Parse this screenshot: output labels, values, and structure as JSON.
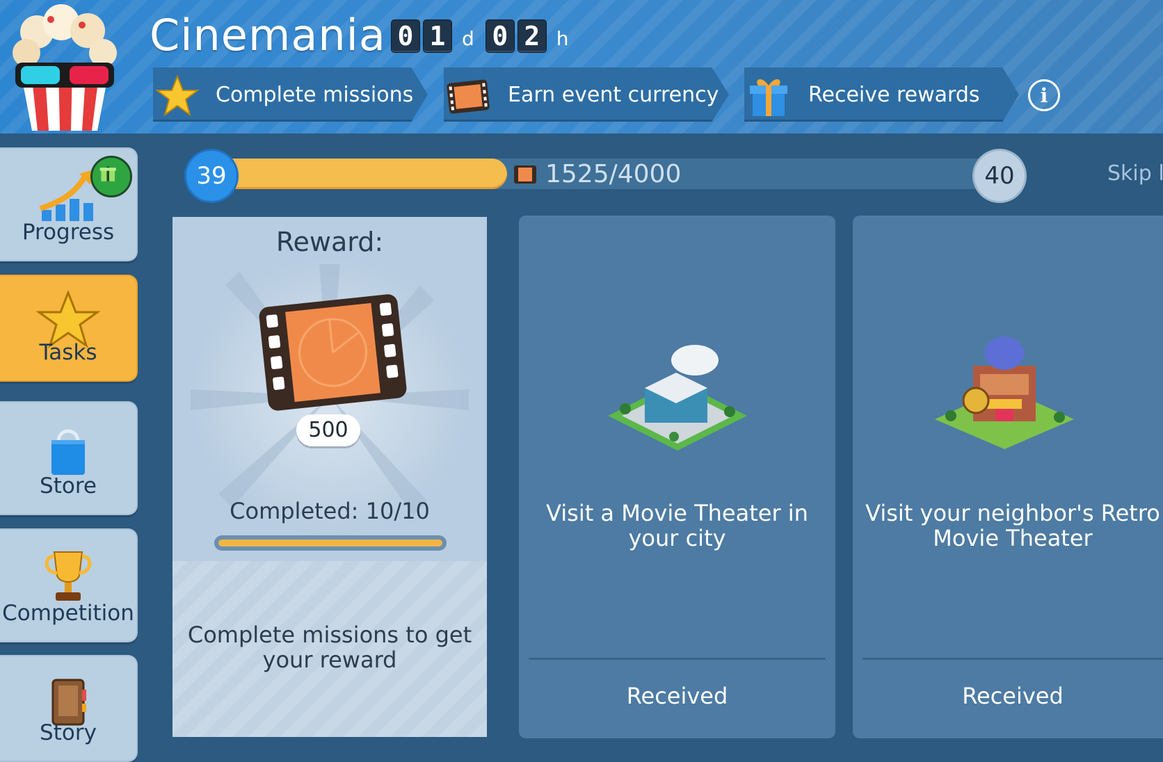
{
  "header": {
    "title": "Cinemania",
    "timer": {
      "days": [
        "0",
        "1"
      ],
      "days_unit": "d",
      "hours": [
        "0",
        "2"
      ],
      "hours_unit": "h"
    },
    "steps": [
      {
        "label": "Complete missions",
        "icon": "star-icon"
      },
      {
        "label": "Earn event currency",
        "icon": "film-reel-icon"
      },
      {
        "label": "Receive rewards",
        "icon": "gift-icon"
      }
    ],
    "info_icon_text": "i"
  },
  "sidebar": {
    "items": [
      {
        "label": "Progress",
        "icon": "progress-chart-icon",
        "active": false
      },
      {
        "label": "Tasks",
        "icon": "star-icon",
        "active": true
      },
      {
        "label": "Store",
        "icon": "shopping-bag-icon",
        "active": false
      },
      {
        "label": "Competition",
        "icon": "trophy-icon",
        "active": false
      },
      {
        "label": "Story",
        "icon": "book-icon",
        "active": false
      }
    ]
  },
  "progress": {
    "current_level": "39",
    "next_level": "40",
    "text": "1525/4000",
    "fraction": 0.38,
    "skip_label": "Skip le"
  },
  "reward_card": {
    "title": "Reward:",
    "amount": "500",
    "completed_text": "Completed: 10/10",
    "completed_fraction": 1.0,
    "hint": "Complete missions to get your reward"
  },
  "tasks": [
    {
      "description": "Visit a Movie Theater in your city",
      "status": "Received",
      "icon": "movie-theater-building-icon"
    },
    {
      "description": "Visit your neighbor's Retro Movie Theater",
      "status": "Received",
      "icon": "retro-movie-theater-building-icon"
    }
  ],
  "colors": {
    "accent": "#f7b640",
    "header_blue": "#2f86d0",
    "card_blue": "#4d7ba3",
    "level_blue": "#2b90e8"
  }
}
